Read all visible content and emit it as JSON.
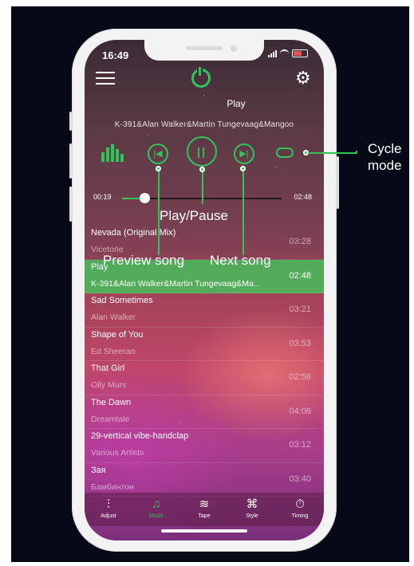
{
  "status_bar": {
    "time": "16:49"
  },
  "player": {
    "title": "Play",
    "artist": "K-391&Alan Walker&Martin Tungevaag&Mangoo",
    "current_time": "00:19",
    "total_time": "02:48",
    "progress": 0.14
  },
  "playlist": [
    {
      "title": "Nevada (Original Mix)",
      "artist": "Vicetone",
      "duration": "03:28",
      "active": false
    },
    {
      "title": "Play",
      "artist": "K-391&Alan Walker&Martin Tungevaag&Ma...",
      "duration": "02:48",
      "active": true
    },
    {
      "title": "Sad Sometimes",
      "artist": "Alan Walker",
      "duration": "03:21",
      "active": false
    },
    {
      "title": "Shape of You",
      "artist": "Ed Sheeran",
      "duration": "03:53",
      "active": false
    },
    {
      "title": "That Girl",
      "artist": "Olly Murs",
      "duration": "02:56",
      "active": false
    },
    {
      "title": "The Dawn",
      "artist": "Dreamtale",
      "duration": "04:06",
      "active": false
    },
    {
      "title": "29-vertical vibe-handclap",
      "artist": "Various Artists",
      "duration": "03:12",
      "active": false
    },
    {
      "title": "Зая",
      "artist": "Бамбинтон",
      "duration": "03:40",
      "active": false
    }
  ],
  "tabs": [
    {
      "label": "Adjust",
      "icon": "sliders-icon",
      "active": false
    },
    {
      "label": "Music",
      "icon": "music-note-icon",
      "active": true
    },
    {
      "label": "Tape",
      "icon": "tape-icon",
      "active": false
    },
    {
      "label": "Style",
      "icon": "command-icon",
      "active": false
    },
    {
      "label": "Timing",
      "icon": "timer-icon",
      "active": false
    }
  ],
  "annotations": {
    "play_pause": "Play/Pause",
    "preview_song": "Preview song",
    "next_song": "Next song",
    "cycle_mode_line1": "Cycle",
    "cycle_mode_line2": "mode"
  },
  "colors": {
    "accent": "#2fc55a",
    "background": "#050a16"
  }
}
